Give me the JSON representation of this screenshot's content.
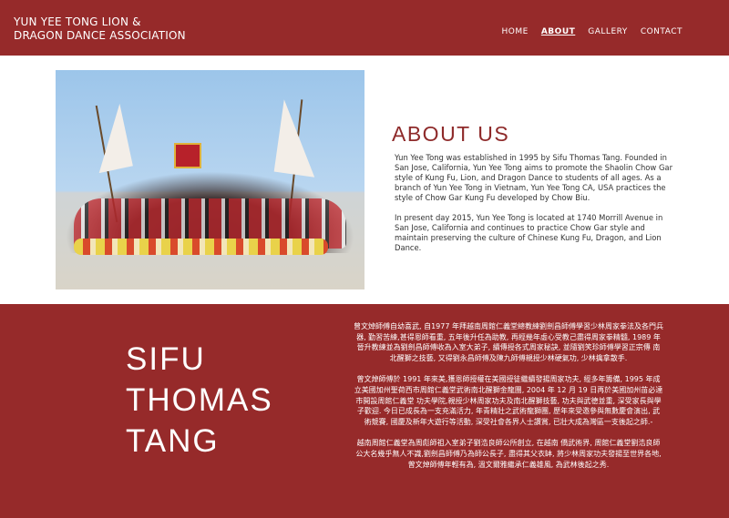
{
  "header": {
    "brand": "YUN YEE TONG LION & DRAGON DANCE ASSOCIATION",
    "nav": [
      {
        "label": "HOME",
        "active": false
      },
      {
        "label": "ABOUT",
        "active": true
      },
      {
        "label": "GALLERY",
        "active": false
      },
      {
        "label": "CONTACT",
        "active": false
      }
    ]
  },
  "about": {
    "photo_icon": "group-photo",
    "title": "ABOUT US",
    "paragraphs": [
      "Yun Yee Tong was established in 1995 by Sifu Thomas Tang. Founded in San Jose, California, Yun Yee Tong aims to promote the Shaolin Chow Gar style of Kung Fu, Lion, and Dragon Dance to students of all ages. As a branch of Yun Yee Tong in Vietnam, Yun Yee Tong CA, USA practices the style of Chow Gar Kung Fu developed by Chow Biu.",
      "In present day 2015, Yun Yee Tong is located at 1740 Morrill Avenue in San Jose, California and continues to practice Chow Gar style and maintain preserving the culture of Chinese Kung Fu, Dragon, and Lion Dance."
    ]
  },
  "sifu": {
    "name": "SIFU THOMAS TANG",
    "paragraphs": [
      "曾文焯師傅自幼喜武, 自1977 年拜越南周館仁義堂總教練劉劍昌師傅學習少林周家拳法及各門兵器, 勤習苦練,甚得恩師看重, 五年後升任為助教, 再經幾年虛心受教己盡得周家拳精髓, 1989 年晉升教練並為劉劍昌師傅收為入室大弟子, 續傳授各式周家秘訣, 並隨劉笑珍師傅學習正宗傳 南北醒獅之技藝, 又得劉永昌師傅及陳九師傅親授少林硬氣功, 少林擒拿散手.",
      "曾文焯師傅於 1991 年來美,獲恩師授權在美國授徒繼續發揚周家功夫, 經多年籌備, 1995 年成立美國加州聖荷西市周館仁義堂武術南北醒獅金龍團, 2004 年 12 月 19 日再於美國加州苗必達市開設周館仁義堂 功夫學院,親授少林周家功夫及南北醒獅技藝, 功夫與武德並重, 深受家長與學子歡迎. 今日已成長為一支充滿活力, 年青精壯之武術龍獅團, 歷年來受邀參與無數慶會演出, 武術競賽, 國慶及新年大遊行等活動, 深受社會各界人士讚賞, 已壯大成為灣區一支後起之師.-",
      "越南周館仁義堂為周彪師祖入室弟子劉浩良師公所創立, 在越南 僑武術界, 周館仁義堂劉浩良師公大名幾乎無人不識,劉劍昌師傅乃為師公長子, 盡得其父衣缽, 將少林周家功夫發揚至世界各地, 曾文焯師傅年輕有為, 溫文爾雅繼承仁義雄風, 為武林後起之秀."
    ]
  }
}
